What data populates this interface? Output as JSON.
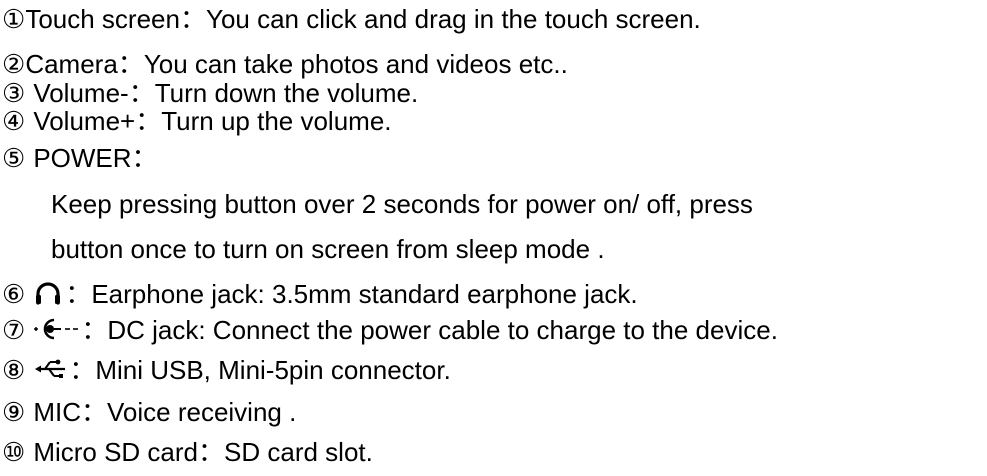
{
  "items": [
    {
      "marker": "①",
      "label": "Touch screen",
      "sep": "：",
      "text": "You can click and drag in the touch screen."
    },
    {
      "marker": "②",
      "label": "Camera",
      "sep": "：",
      "text": "You can take photos and videos etc.."
    },
    {
      "marker": "③",
      "label": "Volume-",
      "sep": "：",
      "text": "Turn down the volume."
    },
    {
      "marker": "④",
      "label": "Volume+",
      "sep": "：",
      "text": "Turn up the volume."
    },
    {
      "marker": "⑤",
      "label": "POWER",
      "sep": "：",
      "detail": [
        "Keep pressing button over 2 seconds for power on/ off, press",
        "button once to turn on screen from sleep mode ."
      ]
    },
    {
      "marker": "⑥",
      "icon": "headphone-icon",
      "sep": "：",
      "text": "Earphone jack: 3.5mm standard earphone jack."
    },
    {
      "marker": "⑦",
      "icon": "dc-power-jack-icon",
      "sep": "：",
      "text": "DC jack: Connect the power cable to charge to the device."
    },
    {
      "marker": "⑧",
      "icon": "usb-icon",
      "sep": "：",
      "text": "Mini USB, Mini-5pin connector."
    },
    {
      "marker": "⑨",
      "label": "MIC",
      "sep": "：",
      "text": "Voice receiving ."
    },
    {
      "marker": "⑩",
      "label": "Micro SD card",
      "sep": "：",
      "text": "SD card slot."
    }
  ]
}
